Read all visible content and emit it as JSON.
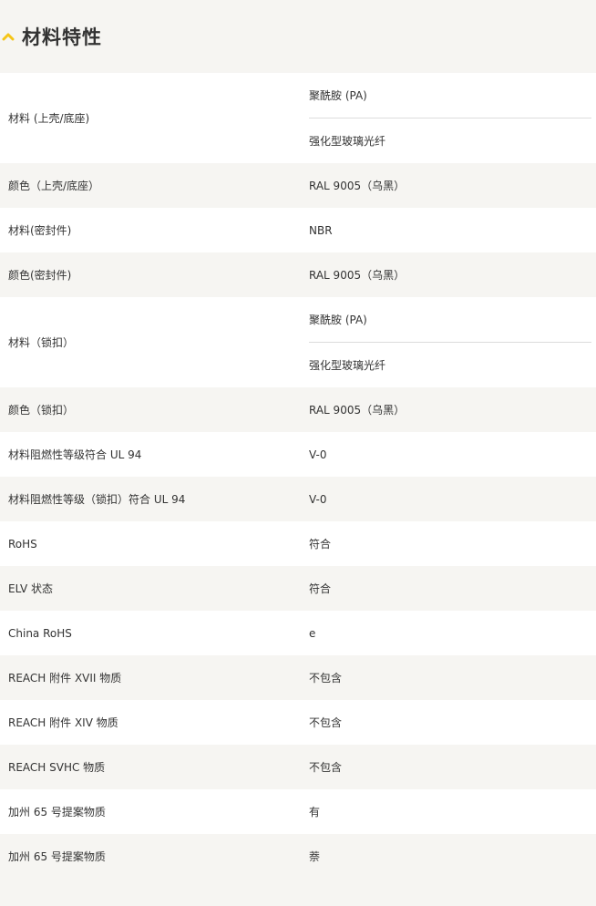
{
  "section": {
    "title": "材料特性",
    "accent_color": "#f5c518",
    "icon": "chevron-up-icon"
  },
  "rows": [
    {
      "label": "材料 (上壳/底座)",
      "values": [
        "聚酰胺 (PA)",
        "强化型玻璃光纤"
      ]
    },
    {
      "label": "颜色（上壳/底座）",
      "values": [
        "RAL 9005（乌黑）"
      ]
    },
    {
      "label": "材料(密封件)",
      "values": [
        "NBR"
      ]
    },
    {
      "label": "颜色(密封件)",
      "values": [
        "RAL 9005（乌黑）"
      ]
    },
    {
      "label": "材料（锁扣）",
      "values": [
        "聚酰胺 (PA)",
        "强化型玻璃光纤"
      ]
    },
    {
      "label": "颜色（锁扣）",
      "values": [
        "RAL 9005（乌黑）"
      ]
    },
    {
      "label": "材料阻燃性等级符合 UL 94",
      "values": [
        "V-0"
      ]
    },
    {
      "label": "材料阻燃性等级（锁扣）符合 UL 94",
      "values": [
        "V-0"
      ]
    },
    {
      "label": "RoHS",
      "values": [
        "符合"
      ]
    },
    {
      "label": "ELV 状态",
      "values": [
        "符合"
      ]
    },
    {
      "label": "China RoHS",
      "values": [
        "e"
      ]
    },
    {
      "label": "REACH 附件 XVII 物质",
      "values": [
        "不包含"
      ]
    },
    {
      "label": "REACH 附件 XIV 物质",
      "values": [
        "不包含"
      ]
    },
    {
      "label": "REACH SVHC 物质",
      "values": [
        "不包含"
      ]
    },
    {
      "label": "加州 65 号提案物质",
      "values": [
        "有"
      ]
    },
    {
      "label": "加州 65 号提案物质",
      "values": [
        "萘"
      ]
    }
  ]
}
